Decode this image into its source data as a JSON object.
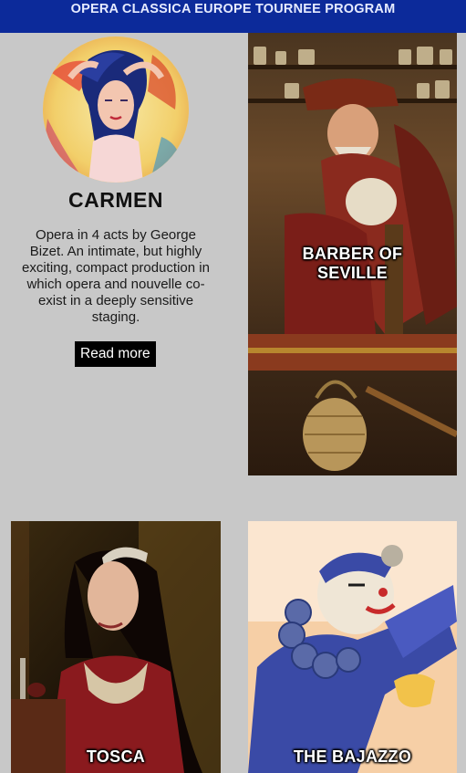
{
  "header": {
    "title": "OPERA CLASSICA EUROPE TOURNEE PROGRAM"
  },
  "operas": {
    "carmen": {
      "title": "CARMEN",
      "description": "Opera in 4 acts by George Bizet. An intimate, but highly exciting, compact production in which opera and nouvelle co-exist in a deeply sensitive staging.",
      "button_label": "Read more"
    },
    "barber": {
      "title": "BARBER OF SEVILLE"
    },
    "tosca": {
      "title": "TOSCA"
    },
    "bajazzo": {
      "title": "THE BAJAZZO"
    }
  },
  "colors": {
    "header_bg": "#0c2a9a",
    "page_bg": "#c8c8c8",
    "button_bg": "#000000"
  }
}
